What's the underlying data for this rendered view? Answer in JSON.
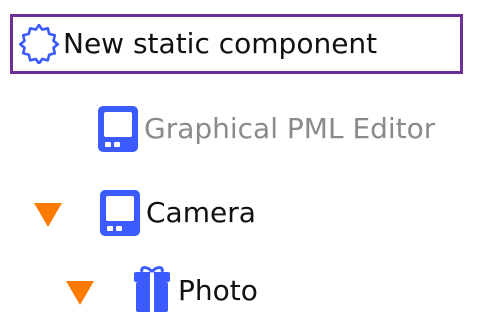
{
  "tree": {
    "new_component": {
      "label": "New static component",
      "icon": "gear-outline-icon",
      "highlight_color": "#6b2f97",
      "icon_color": "#3b5bff"
    },
    "items": [
      {
        "label": "Graphical PML Editor",
        "icon": "device-icon",
        "icon_color": "#3b5bff",
        "text_color": "#8a8a8a",
        "disclosure": null
      },
      {
        "label": "Camera",
        "icon": "device-icon",
        "icon_color": "#3b5bff",
        "text_color": "#111111",
        "disclosure": "expanded-triangle-icon",
        "disclosure_color": "#ff7a00"
      },
      {
        "label": "Photo",
        "icon": "gift-icon",
        "icon_color": "#3b5bff",
        "text_color": "#111111",
        "disclosure": "expanded-triangle-icon",
        "disclosure_color": "#ff7a00"
      }
    ]
  }
}
